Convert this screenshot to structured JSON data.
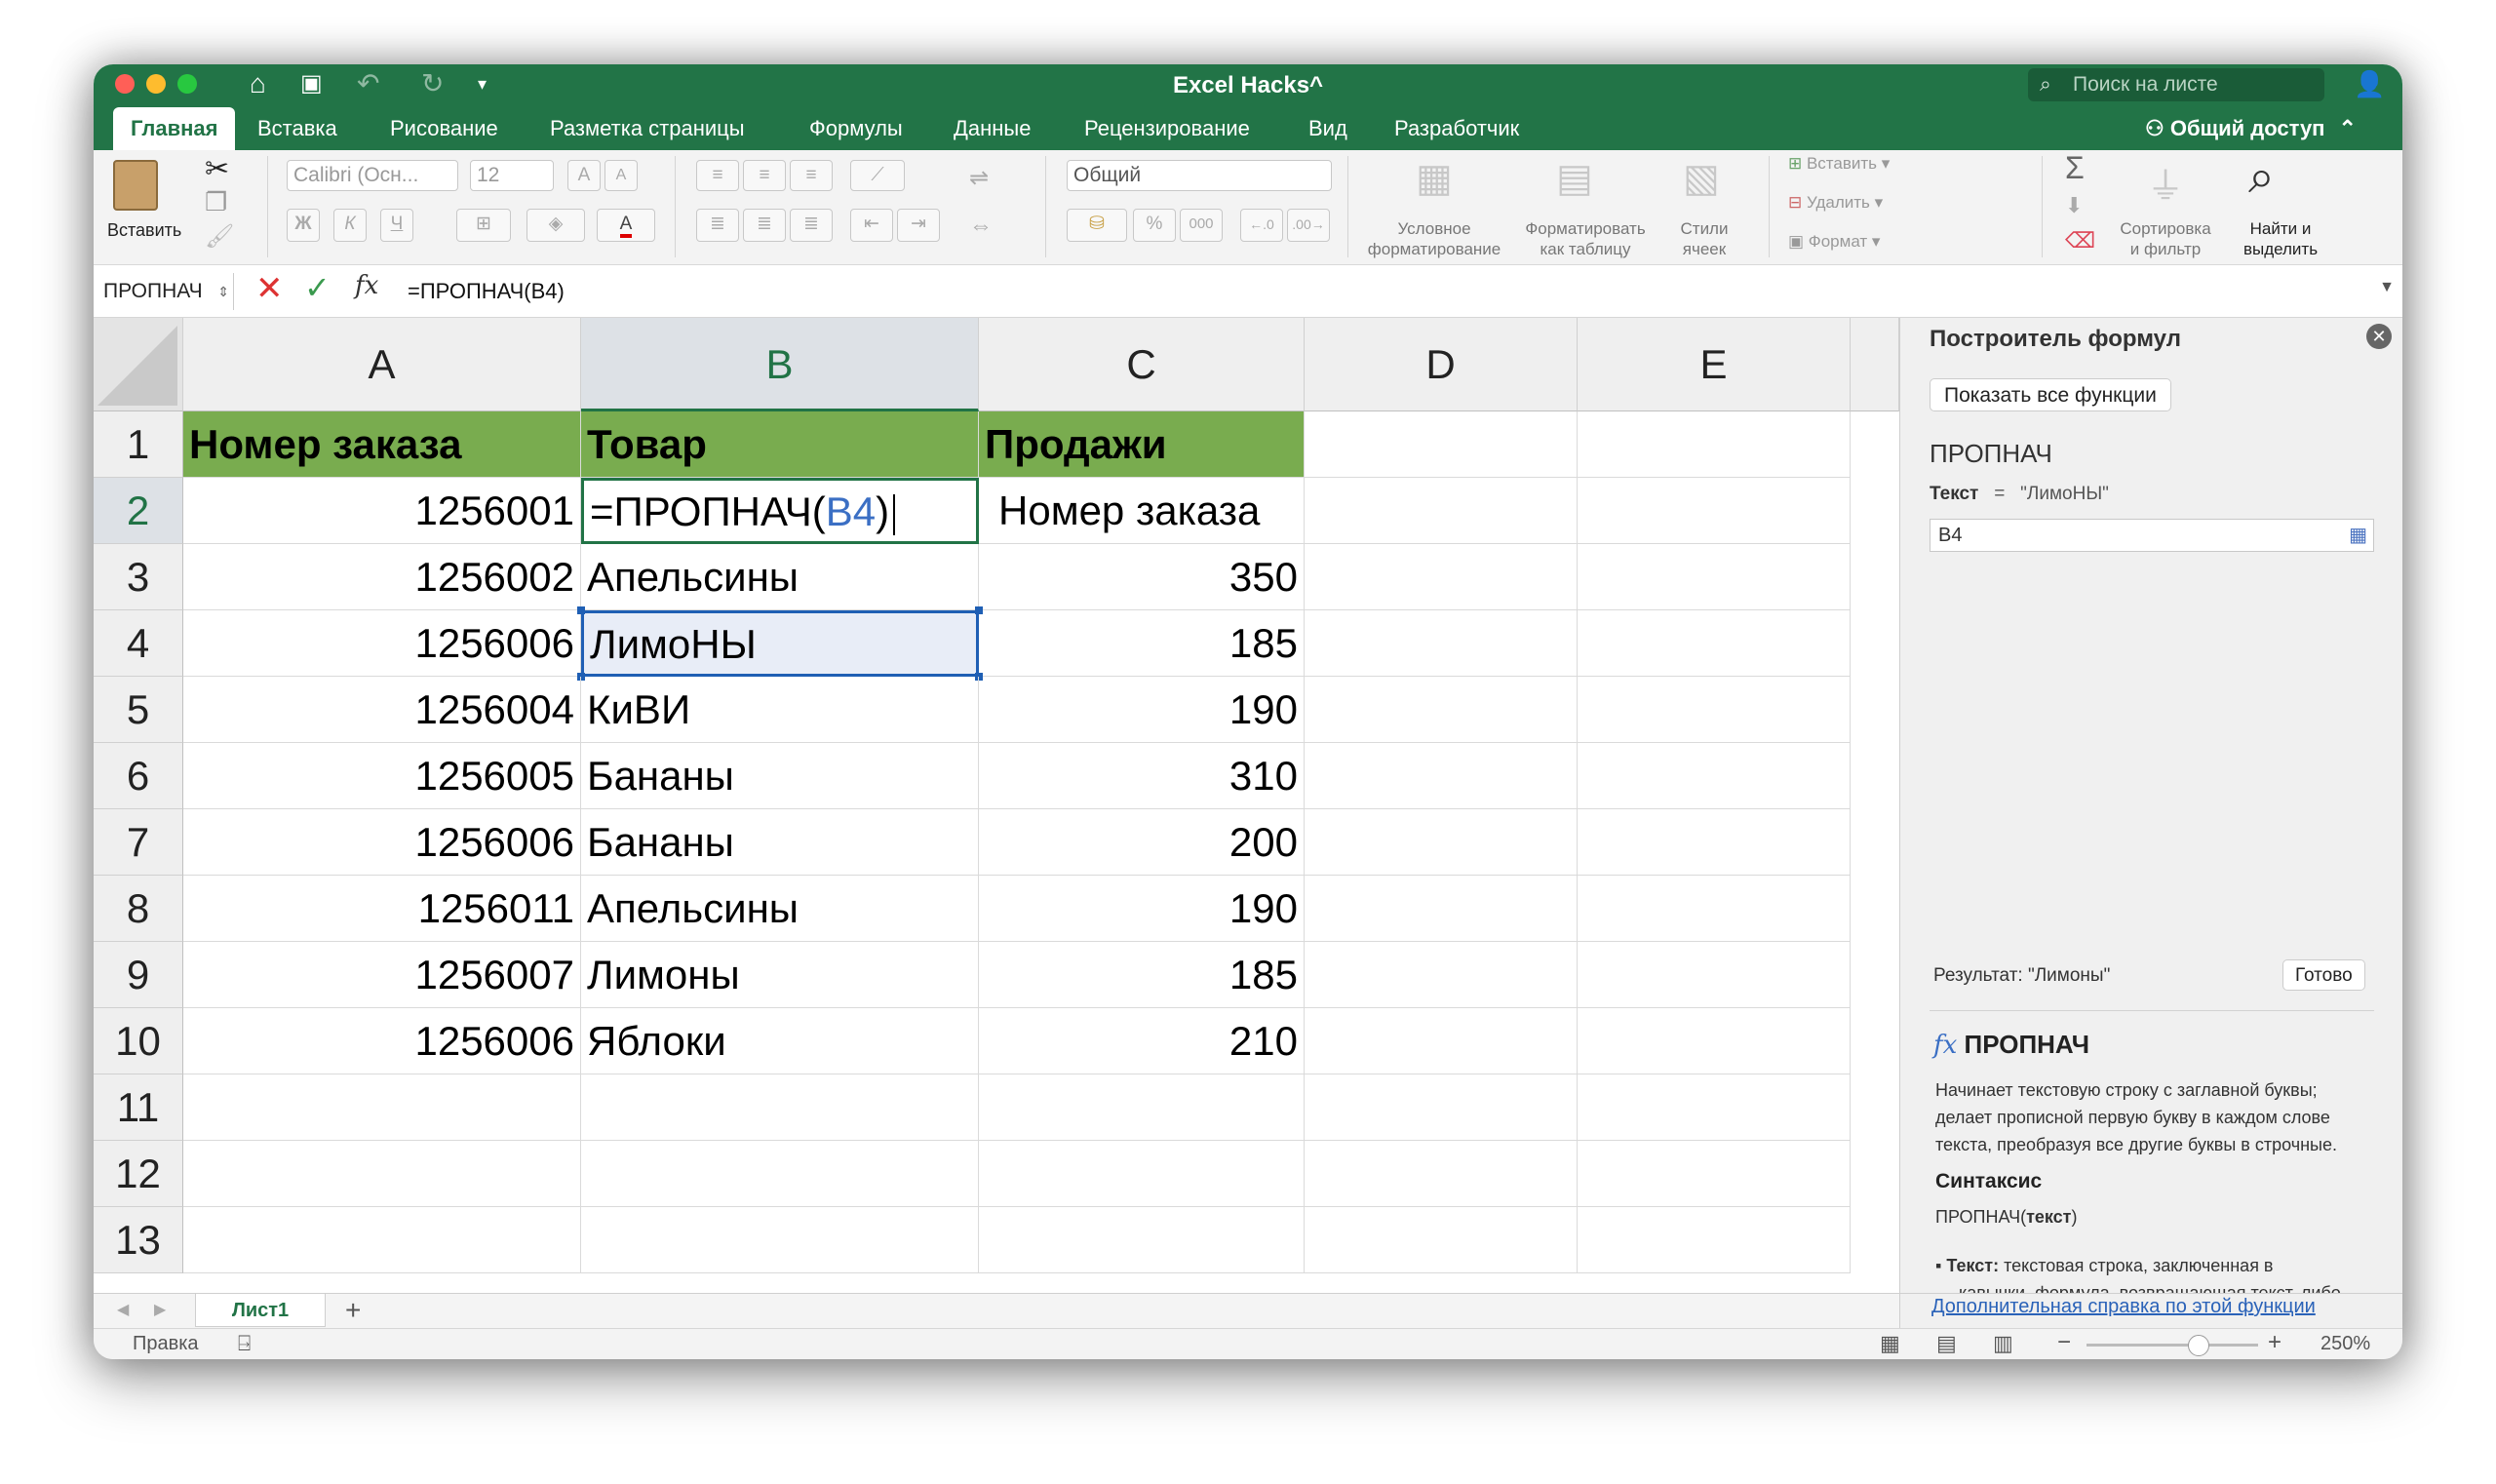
{
  "window": {
    "title": "Excel Hacks^",
    "search_placeholder": "Поиск на листе",
    "share_label": "Общий доступ"
  },
  "tabs": [
    "Главная",
    "Вставка",
    "Рисование",
    "Разметка страницы",
    "Формулы",
    "Данные",
    "Рецензирование",
    "Вид",
    "Разработчик"
  ],
  "ribbon": {
    "paste_label": "Вставить",
    "font_name": "Calibri (Осн...",
    "font_size": "12",
    "bold": "Ж",
    "italic": "К",
    "underline": "Ч",
    "grow_font": "A",
    "shrink_font": "A",
    "font_color_letter": "A",
    "number_format": "Общий",
    "percent": "%",
    "thousands": "000",
    "conditional_formatting": [
      "Условное",
      "форматирование"
    ],
    "format_as_table": [
      "Форматировать",
      "как таблицу"
    ],
    "cell_styles": [
      "Стили",
      "ячеек"
    ],
    "insert_label": "Вставить",
    "delete_label": "Удалить",
    "format_label": "Формат",
    "sort_filter": [
      "Сортировка",
      "и фильтр"
    ],
    "find_select": [
      "Найти и",
      "выделить"
    ],
    "sigma": "Σ"
  },
  "formula_bar": {
    "name_box": "ПРОПНАЧ",
    "fx": "fx",
    "formula_plain": "=ПРОПНАЧ(B4)"
  },
  "sheet": {
    "columns": [
      "A",
      "B",
      "C",
      "D",
      "E"
    ],
    "rows": [
      "1",
      "2",
      "3",
      "4",
      "5",
      "6",
      "7",
      "8",
      "9",
      "10",
      "11",
      "12",
      "13"
    ],
    "header": {
      "A": "Номер заказа",
      "B": "Товар",
      "C": "Продажи"
    },
    "editing_cell": {
      "prefix": "=ПРОПНАЧ(",
      "ref": "B4",
      "suffix": ")"
    },
    "c2": "Номер заказа",
    "data": [
      {
        "a": "1256001",
        "b": "",
        "c": ""
      },
      {
        "a": "1256002",
        "b": "Апельсины",
        "c": "350"
      },
      {
        "a": "1256006",
        "b": "ЛимоНЫ",
        "c": "185"
      },
      {
        "a": "1256004",
        "b": "КиВИ",
        "c": "190"
      },
      {
        "a": "1256005",
        "b": "Бананы",
        "c": "310"
      },
      {
        "a": "1256006",
        "b": "Бананы",
        "c": "200"
      },
      {
        "a": "1256011",
        "b": "Апельсины",
        "c": "190"
      },
      {
        "a": "1256007",
        "b": "Лимоны",
        "c": "185"
      },
      {
        "a": "1256006",
        "b": "Яблоки",
        "c": "210"
      }
    ]
  },
  "panel": {
    "title": "Построитель формул",
    "show_all": "Показать все функции",
    "func_name": "ПРОПНАЧ",
    "arg_label": "Текст",
    "arg_eq": "=",
    "arg_value": "\"ЛимоНЫ\"",
    "arg_input": "B4",
    "result_label": "Результат: \"Лимоны\"",
    "done": "Готово",
    "help_title": "ПРОПНАЧ",
    "help_fx": "fx",
    "desc_lines": [
      "Начинает текстовую строку с заглавной буквы;",
      "делает прописной первую букву в каждом слове",
      "текста, преобразуя все другие буквы в строчные."
    ],
    "syntax_heading": "Синтаксис",
    "syntax": "ПРОПНАЧ(",
    "syntax_arg": "текст",
    "syntax_close": ")",
    "bullet_term": "Текст:",
    "bullet_lines": [
      "текстовая строка, заключенная в",
      "кавычки, формула, возвращающая текст, либо"
    ],
    "more_help": "Дополнительная справка по этой функции"
  },
  "sheet_tabs": {
    "active": "Лист1",
    "add": "+"
  },
  "status": {
    "mode": "Правка",
    "zoom": "250%"
  },
  "colors": {
    "titlebar": "#227447",
    "header_fill": "#79ac4f",
    "selection": "#1f5fb4",
    "ref_blue": "#3b6fc4"
  }
}
